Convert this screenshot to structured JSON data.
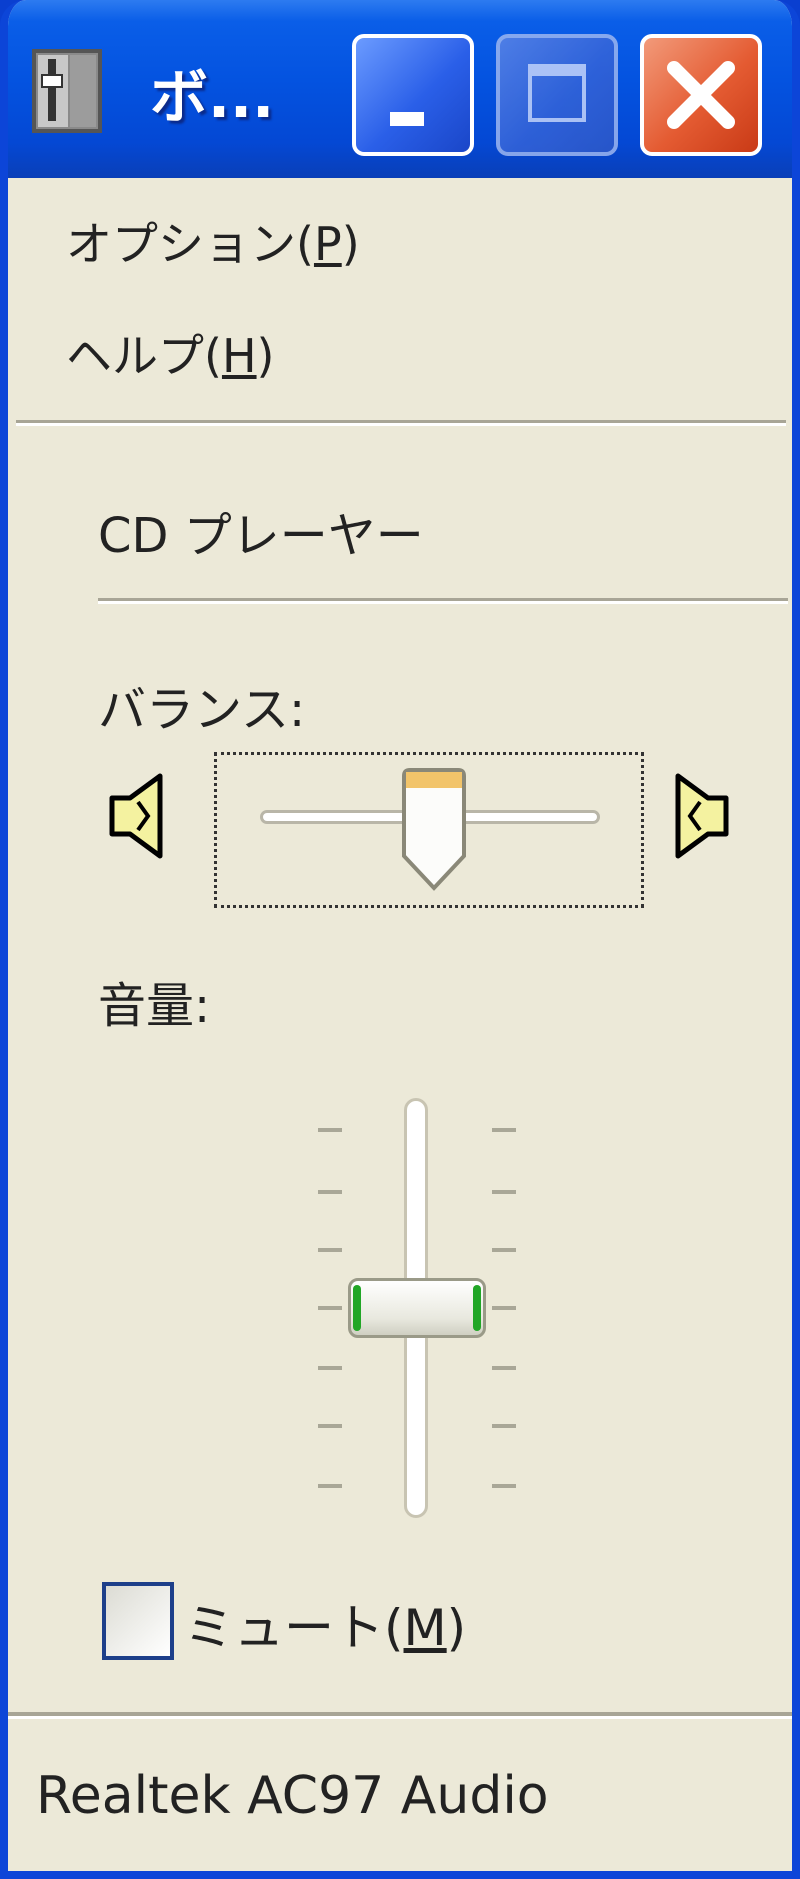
{
  "window": {
    "title": "ボ..."
  },
  "menu": [
    {
      "text": "オプション(",
      "key": "P",
      "suffix": ")"
    },
    {
      "text": "ヘルプ(",
      "key": "H",
      "suffix": ")"
    }
  ],
  "section": {
    "title": "CD プレーヤー"
  },
  "balance": {
    "label": "バランス:",
    "value": 0.5
  },
  "volume": {
    "label": "音量:",
    "value": 0.5
  },
  "mute": {
    "text": "ミュート(",
    "key": "M",
    "suffix": ")",
    "checked": false
  },
  "status": {
    "device": "Realtek  AC97  Audio"
  }
}
